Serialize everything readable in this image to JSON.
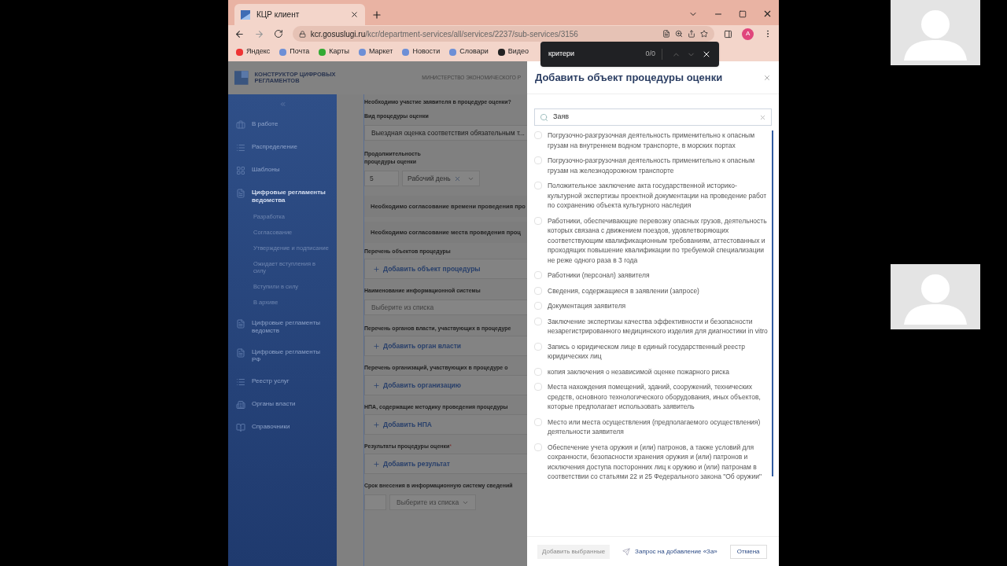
{
  "browser": {
    "tab_title": "КЦР клиент",
    "url_host": "kcr.gosuslugi.ru",
    "url_path": "/kcr/department-services/all/services/2237/sub-services/3156",
    "profile_initial": "A",
    "bookmarks": [
      "Яндекс",
      "Почта",
      "Карты",
      "Маркет",
      "Новости",
      "Словари",
      "Видео"
    ]
  },
  "find_bar": {
    "query": "критери",
    "count": "0/0"
  },
  "header": {
    "logo_text": "КОНСТРУКТОР ЦИФРОВЫХ РЕГЛАМЕНТОВ",
    "ministry": "МИНИСТЕРСТВО ЭКОНОМИЧЕСКОГО Р"
  },
  "sidebar": {
    "items": [
      {
        "label": "В работе",
        "expanded": false
      },
      {
        "label": "Распределение",
        "expanded": false
      },
      {
        "label": "Шаблоны",
        "expanded": false
      },
      {
        "label": "Цифровые регламенты ведомства",
        "expanded": true,
        "children": [
          "Разработка",
          "Согласование",
          "Утверждение и подписание",
          "Ожидает вступления в силу",
          "Вступили в силу",
          "В архиве"
        ]
      },
      {
        "label": "Цифровые регламенты ведомств",
        "expanded": false
      },
      {
        "label": "Цифровые регламенты РФ",
        "expanded": false
      },
      {
        "label": "Реестр услуг",
        "expanded": false
      },
      {
        "label": "Органы власти",
        "expanded": false
      },
      {
        "label": "Справочники",
        "expanded": false
      }
    ]
  },
  "form": {
    "fields": [
      {
        "kind": "question",
        "label": "Необходимо участие заявителя в процедуре оценки?"
      },
      {
        "kind": "select",
        "label": "Вид процедуры оценки",
        "value": "Выездная оценка соответствия обязательным т..."
      },
      {
        "kind": "duration",
        "label": "Продолжительность процедуры оценки",
        "value": "5",
        "unit": "Рабочий день"
      },
      {
        "kind": "toggle",
        "label": "Необходимо согласование времени проведения про"
      },
      {
        "kind": "toggle",
        "label": "Необходимо согласование места проведения проц"
      },
      {
        "kind": "add",
        "label": "Перечень объектов процедуры",
        "button": "Добавить объект процедуры"
      },
      {
        "kind": "select",
        "label": "Наименование информационной системы",
        "placeholder": "Выберите из списка"
      },
      {
        "kind": "add",
        "label": "Перечень органов власти, участвующих в процедуре",
        "button": "Добавить орган власти"
      },
      {
        "kind": "add",
        "label": "Перечень организаций, участвующих в процедуре о",
        "button": "Добавить организацию"
      },
      {
        "kind": "add",
        "label": "НПА, содержащие методику проведения процедуры",
        "button": "Добавить НПА"
      },
      {
        "kind": "add",
        "label": "Результаты процедуры оценки",
        "required_mark": "*",
        "button": "Добавить результат"
      },
      {
        "kind": "deadline",
        "label": "Срок внесения в информационную систему сведений",
        "placeholder": "Выберите из списка"
      }
    ]
  },
  "modal": {
    "title": "Добавить объект процедуры оценки",
    "search": {
      "value": "Заяв"
    },
    "options": [
      {
        "label": "Погрузочно-разгрузочная деятельность применительно к опасным грузам на внутреннем водном транспорте, в морских портах",
        "checked": false
      },
      {
        "label": "Погрузочно-разгрузочная деятельность применительно к опасным грузам на железнодорожном транспорте",
        "checked": false
      },
      {
        "label": "Положительное заключение акта государственной историко-культурной экспертизы проектной документации на проведение работ по сохранению объекта культурного наследия",
        "checked": false
      },
      {
        "label": "Работники, обеспечивающие перевозку опасных грузов, деятельность которых связана с движением поездов, удовлетворяющих соответствующим квалификационным требованиям, аттестованных и проходящих повышение квалификации по требуемой специализации не реже одного раза в 3 года",
        "checked": false
      },
      {
        "label": "Работники (персонал) заявителя",
        "checked": false
      },
      {
        "label": "Сведения, содержащиеся в заявлении (запросе)",
        "checked": false
      },
      {
        "label": "Документация заявителя",
        "checked": false
      },
      {
        "label": "Заключение экспертизы качества эффективности и безопасности незарегистрированного медицинского изделия для диагностики in vitro",
        "checked": false
      },
      {
        "label": "Запись о юридическом лице в единый государственный реестр юридических лиц",
        "checked": false
      },
      {
        "label": "копия заключения о независимой оценке пожарного риска",
        "checked": false
      },
      {
        "label": "Места нахождения помещений, зданий, сооружений, технических средств, основного технологического оборудования, иных объектов, которые предполагает использовать заявитель",
        "checked": false
      },
      {
        "label": "Место или места осуществления (предполагаемого осуществления) деятельности заявителя",
        "checked": false
      },
      {
        "label": "Обеспечение учета оружия и (или) патронов, а также условий для сохранности, безопасности хранения оружия и (или) патронов и исключения доступа посторонних лиц к оружию и (или) патронам в соответствии со статьями 22 и 25 Федерального закона \"Об оружии\"",
        "checked": false
      }
    ],
    "add_button": {
      "label": "Добавить выбранные",
      "disabled": true
    },
    "request_link": "Запрос на добавление «За»",
    "cancel_button": "Отмена"
  }
}
